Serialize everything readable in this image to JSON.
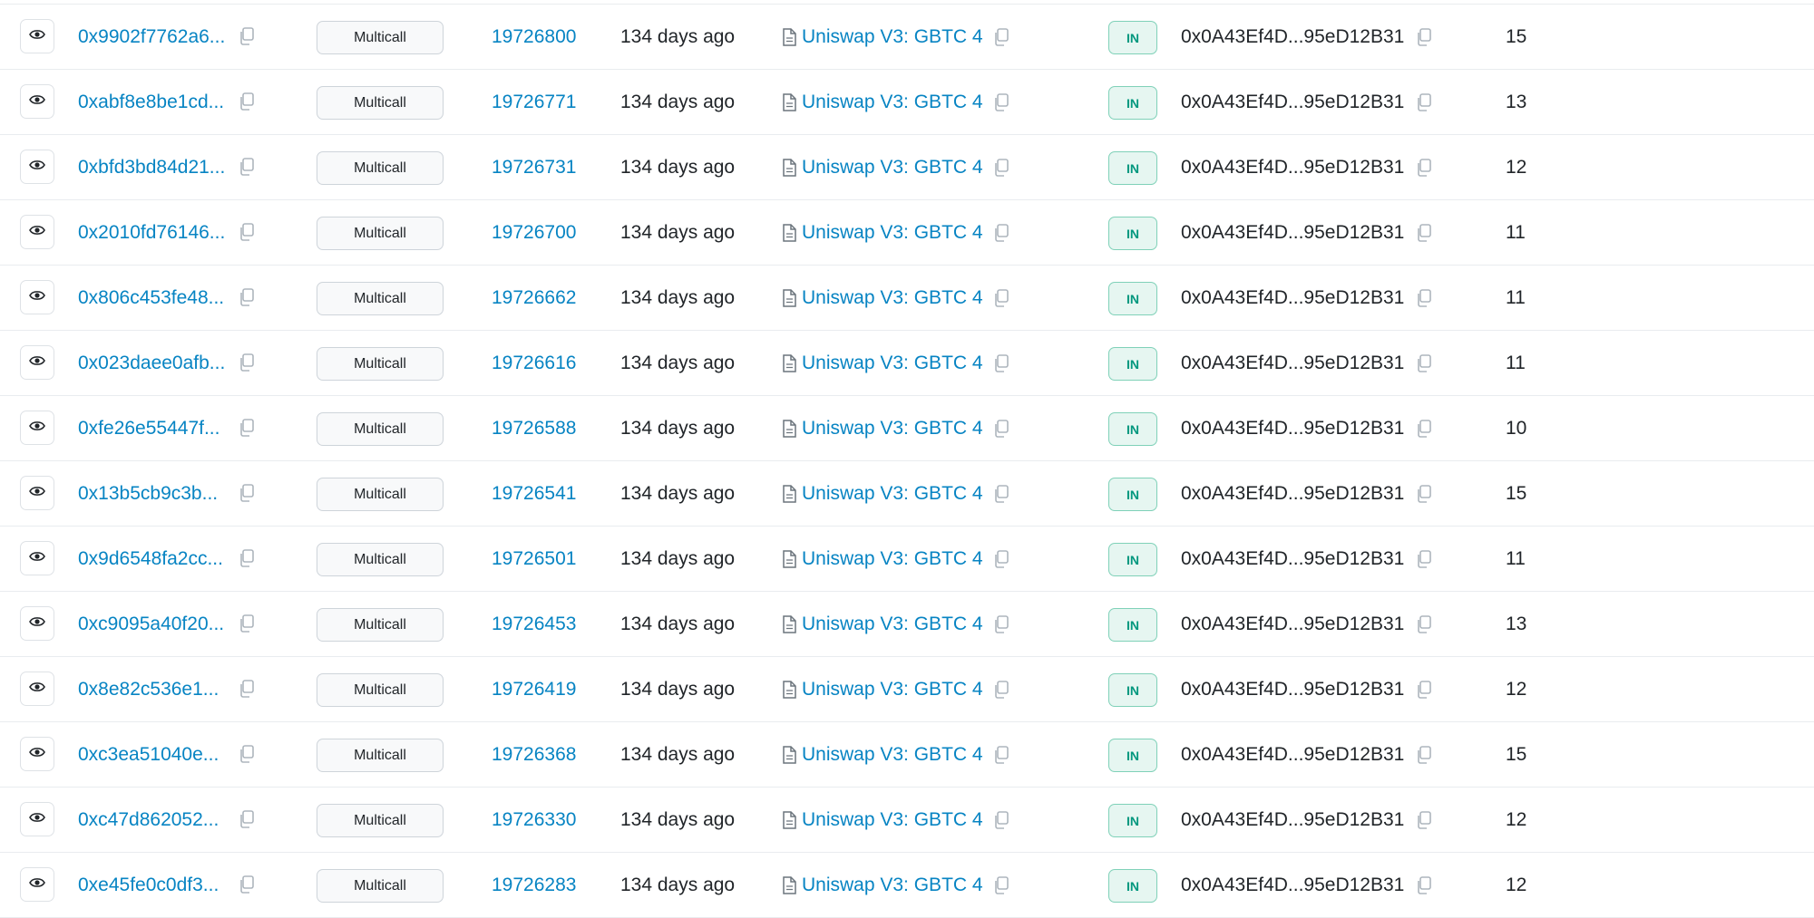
{
  "colors": {
    "link": "#0784c3",
    "in_badge_bg": "#e6f6f1",
    "in_badge_text": "#02977e",
    "row_border": "#e9ecef"
  },
  "icons": {
    "view": "eye-icon",
    "copy": "copy-icon",
    "contract": "document-icon"
  },
  "rows": [
    {
      "hash": "0x9902f7762a6...",
      "method": "Multicall",
      "block": "19726800",
      "age": "134 days ago",
      "from": "Uniswap V3: GBTC 4",
      "direction": "IN",
      "to": "0x0A43Ef4D...95eD12B31",
      "value": "15"
    },
    {
      "hash": "0xabf8e8be1cd...",
      "method": "Multicall",
      "block": "19726771",
      "age": "134 days ago",
      "from": "Uniswap V3: GBTC 4",
      "direction": "IN",
      "to": "0x0A43Ef4D...95eD12B31",
      "value": "13"
    },
    {
      "hash": "0xbfd3bd84d21...",
      "method": "Multicall",
      "block": "19726731",
      "age": "134 days ago",
      "from": "Uniswap V3: GBTC 4",
      "direction": "IN",
      "to": "0x0A43Ef4D...95eD12B31",
      "value": "12"
    },
    {
      "hash": "0x2010fd76146...",
      "method": "Multicall",
      "block": "19726700",
      "age": "134 days ago",
      "from": "Uniswap V3: GBTC 4",
      "direction": "IN",
      "to": "0x0A43Ef4D...95eD12B31",
      "value": "11"
    },
    {
      "hash": "0x806c453fe48...",
      "method": "Multicall",
      "block": "19726662",
      "age": "134 days ago",
      "from": "Uniswap V3: GBTC 4",
      "direction": "IN",
      "to": "0x0A43Ef4D...95eD12B31",
      "value": "11"
    },
    {
      "hash": "0x023daee0afb...",
      "method": "Multicall",
      "block": "19726616",
      "age": "134 days ago",
      "from": "Uniswap V3: GBTC 4",
      "direction": "IN",
      "to": "0x0A43Ef4D...95eD12B31",
      "value": "11"
    },
    {
      "hash": "0xfe26e55447f...",
      "method": "Multicall",
      "block": "19726588",
      "age": "134 days ago",
      "from": "Uniswap V3: GBTC 4",
      "direction": "IN",
      "to": "0x0A43Ef4D...95eD12B31",
      "value": "10"
    },
    {
      "hash": "0x13b5cb9c3b...",
      "method": "Multicall",
      "block": "19726541",
      "age": "134 days ago",
      "from": "Uniswap V3: GBTC 4",
      "direction": "IN",
      "to": "0x0A43Ef4D...95eD12B31",
      "value": "15"
    },
    {
      "hash": "0x9d6548fa2cc...",
      "method": "Multicall",
      "block": "19726501",
      "age": "134 days ago",
      "from": "Uniswap V3: GBTC 4",
      "direction": "IN",
      "to": "0x0A43Ef4D...95eD12B31",
      "value": "11"
    },
    {
      "hash": "0xc9095a40f20...",
      "method": "Multicall",
      "block": "19726453",
      "age": "134 days ago",
      "from": "Uniswap V3: GBTC 4",
      "direction": "IN",
      "to": "0x0A43Ef4D...95eD12B31",
      "value": "13"
    },
    {
      "hash": "0x8e82c536e1...",
      "method": "Multicall",
      "block": "19726419",
      "age": "134 days ago",
      "from": "Uniswap V3: GBTC 4",
      "direction": "IN",
      "to": "0x0A43Ef4D...95eD12B31",
      "value": "12"
    },
    {
      "hash": "0xc3ea51040e...",
      "method": "Multicall",
      "block": "19726368",
      "age": "134 days ago",
      "from": "Uniswap V3: GBTC 4",
      "direction": "IN",
      "to": "0x0A43Ef4D...95eD12B31",
      "value": "15"
    },
    {
      "hash": "0xc47d862052...",
      "method": "Multicall",
      "block": "19726330",
      "age": "134 days ago",
      "from": "Uniswap V3: GBTC 4",
      "direction": "IN",
      "to": "0x0A43Ef4D...95eD12B31",
      "value": "12"
    },
    {
      "hash": "0xe45fe0c0df3...",
      "method": "Multicall",
      "block": "19726283",
      "age": "134 days ago",
      "from": "Uniswap V3: GBTC 4",
      "direction": "IN",
      "to": "0x0A43Ef4D...95eD12B31",
      "value": "12"
    }
  ]
}
